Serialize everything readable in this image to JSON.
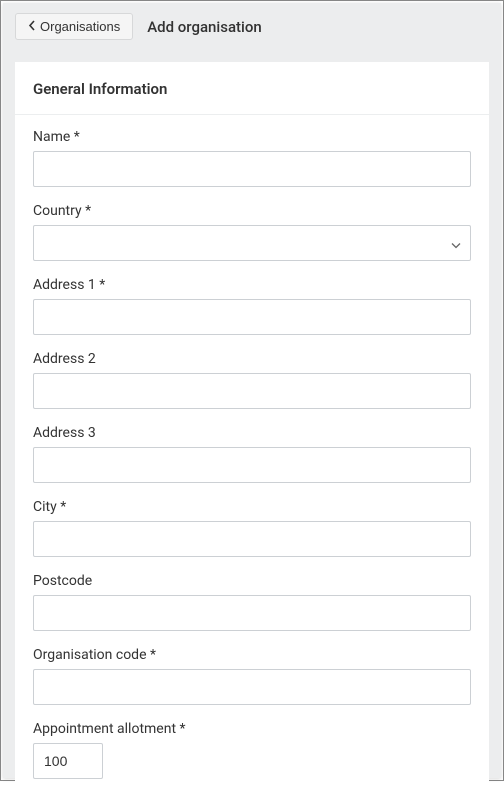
{
  "header": {
    "back_label": "Organisations",
    "page_title": "Add organisation"
  },
  "card": {
    "title": "General Information"
  },
  "form": {
    "name": {
      "label": "Name *",
      "value": ""
    },
    "country": {
      "label": "Country *",
      "value": ""
    },
    "address1": {
      "label": "Address 1 *",
      "value": ""
    },
    "address2": {
      "label": "Address 2",
      "value": ""
    },
    "address3": {
      "label": "Address 3",
      "value": ""
    },
    "city": {
      "label": "City *",
      "value": ""
    },
    "postcode": {
      "label": "Postcode",
      "value": ""
    },
    "org_code": {
      "label": "Organisation code *",
      "value": ""
    },
    "allotment": {
      "label": "Appointment allotment *",
      "value": "100"
    }
  }
}
